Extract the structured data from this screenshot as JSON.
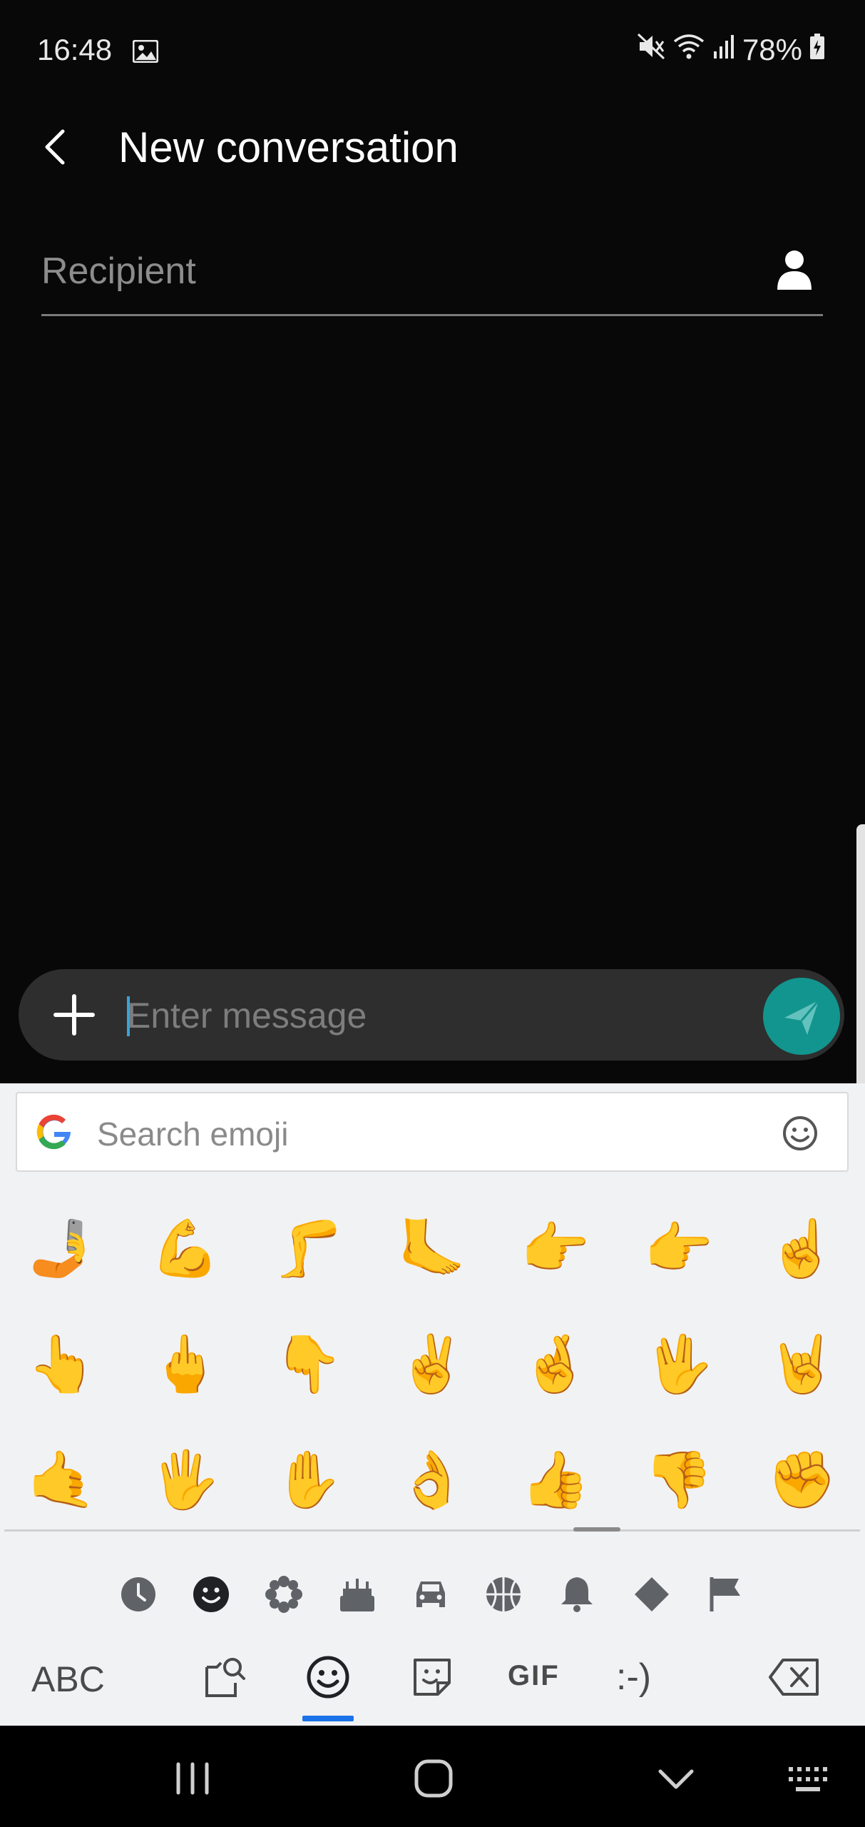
{
  "status_bar": {
    "time": "16:48",
    "battery": "78%",
    "icons": [
      "gallery-icon",
      "mute-icon",
      "wifi-icon",
      "signal-icon",
      "battery-charging-icon"
    ]
  },
  "header": {
    "back_icon": "chevron-left-icon",
    "title": "New conversation"
  },
  "recipient": {
    "placeholder": "Recipient",
    "contact_icon": "person-icon"
  },
  "composer": {
    "add_icon": "plus-icon",
    "placeholder": "Enter message",
    "send_icon": "send-icon",
    "send_color": "#12958f"
  },
  "keyboard": {
    "search_placeholder": "Search emoji",
    "emoji_rows": [
      [
        "🤳",
        "💪",
        "🦵",
        "🦶",
        "👉",
        "👉",
        "☝️"
      ],
      [
        "👆",
        "🖕",
        "👇",
        "✌️",
        "🤞",
        "🖖",
        "🤘"
      ],
      [
        "🤙",
        "🖐️",
        "✋",
        "👌",
        "👍",
        "👎",
        "✊"
      ]
    ],
    "categories": [
      "recent-icon",
      "smiley-icon",
      "nature-icon",
      "food-icon",
      "travel-icon",
      "activity-icon",
      "objects-icon",
      "symbols-icon",
      "flags-icon"
    ],
    "active_category": "smiley-icon",
    "bottom": {
      "abc_label": "ABC",
      "gif_label": "GIF",
      "emoticon_label": ":-)",
      "active_color": "#1a73e8"
    }
  },
  "navbar": {
    "buttons": [
      "recents-icon",
      "home-icon",
      "hide-keyboard-icon",
      "keyboard-switch-icon"
    ]
  }
}
